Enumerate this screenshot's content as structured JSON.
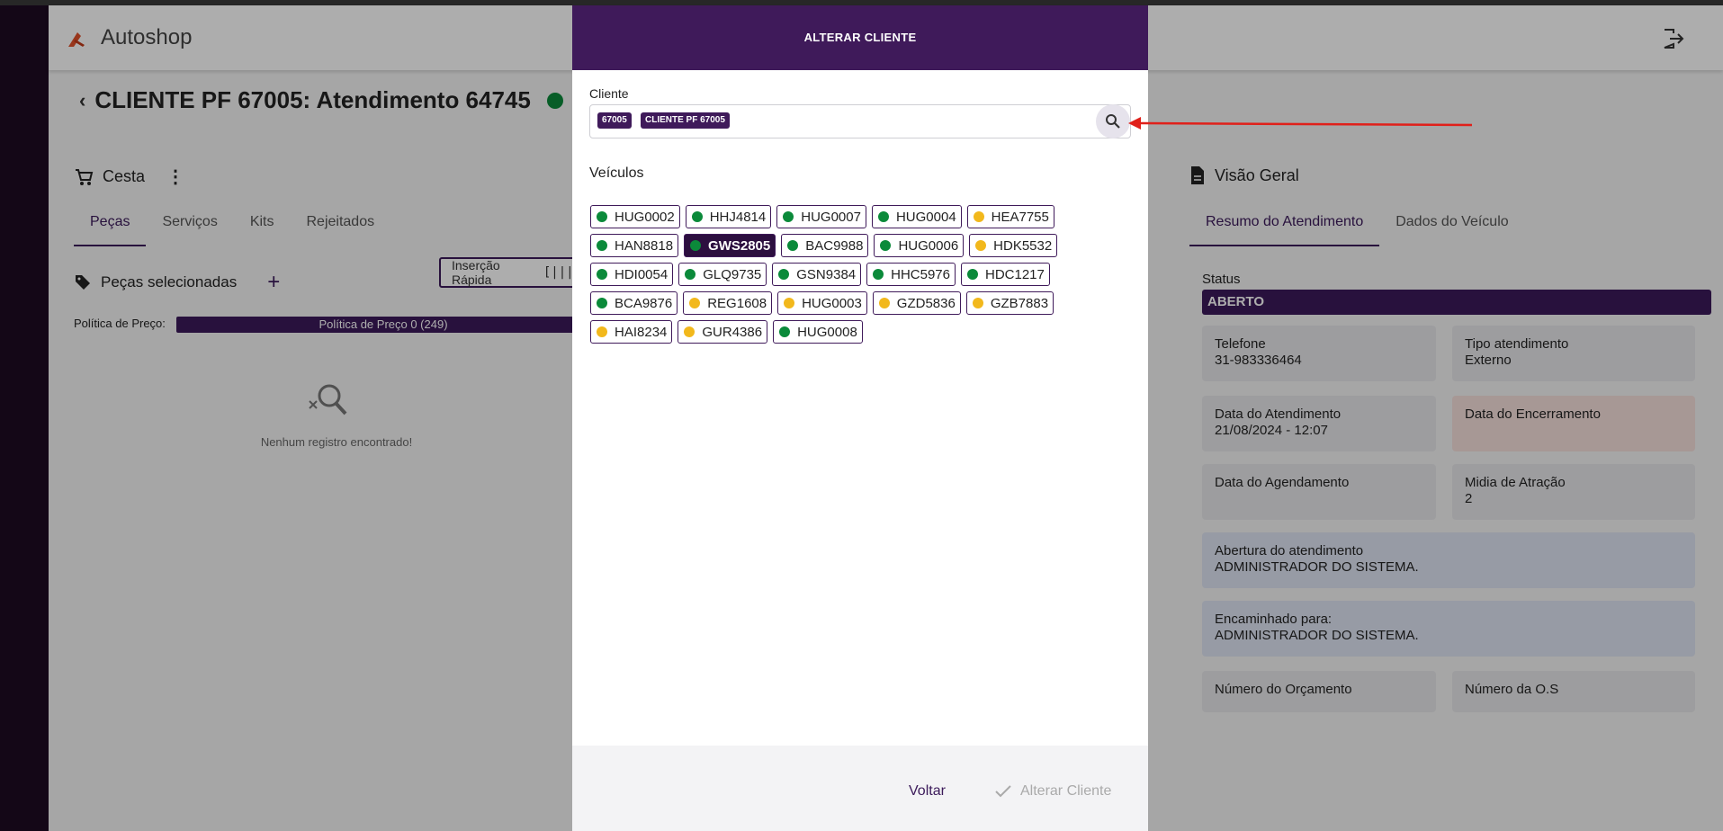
{
  "app": {
    "brand": "Autoshop",
    "page_title": "CLIENTE PF 67005: Atendimento 64745",
    "accent_color": "#3f1a5a",
    "status_dot_color": "#0b8a3a"
  },
  "left": {
    "cesta_label": "Cesta",
    "tabs": [
      "Peças",
      "Serviços",
      "Kits",
      "Rejeitados"
    ],
    "active_tab": "Peças",
    "pecas_selecionadas": "Peças selecionadas",
    "quick_insert_label": "Inserção Rápida",
    "politica_label": "Política de Preço:",
    "politica_value": "Política de Preço 0 (249)",
    "empty_text": "Nenhum registro encontrado!"
  },
  "right": {
    "title": "Visão Geral",
    "tabs": [
      "Resumo do Atendimento",
      "Dados do Veículo"
    ],
    "active_tab": "Resumo do Atendimento",
    "status_label": "Status",
    "status_value": "ABERTO",
    "cards": {
      "telefone": {
        "label": "Telefone",
        "value": "31-983336464"
      },
      "tipo": {
        "label": "Tipo atendimento",
        "value": "Externo"
      },
      "data_atendimento": {
        "label": "Data do Atendimento",
        "value": "21/08/2024 - 12:07"
      },
      "data_encerramento": {
        "label": "Data do Encerramento",
        "value": ""
      },
      "data_agendamento": {
        "label": "Data do Agendamento",
        "value": ""
      },
      "midia": {
        "label": "Midia de Atração",
        "value": "2"
      },
      "abertura": {
        "label": "Abertura do atendimento",
        "value": "ADMINISTRADOR DO SISTEMA."
      },
      "encaminhado": {
        "label": "Encaminhado para:",
        "value": "ADMINISTRADOR DO SISTEMA."
      },
      "orcamento": {
        "label": "Número do Orçamento",
        "value": ""
      },
      "os": {
        "label": "Número da O.S",
        "value": ""
      }
    }
  },
  "dialog": {
    "title": "ALTERAR CLIENTE",
    "cliente_label": "Cliente",
    "chips": [
      "67005",
      "CLIENTE PF 67005"
    ],
    "veiculos_label": "Veículos",
    "vehicles": [
      {
        "plate": "HUG0002",
        "status": "green"
      },
      {
        "plate": "HHJ4814",
        "status": "green"
      },
      {
        "plate": "HUG0007",
        "status": "green"
      },
      {
        "plate": "HUG0004",
        "status": "green"
      },
      {
        "plate": "HEA7755",
        "status": "yellow"
      },
      {
        "plate": "HAN8818",
        "status": "green"
      },
      {
        "plate": "GWS2805",
        "status": "green",
        "selected": true
      },
      {
        "plate": "BAC9988",
        "status": "green"
      },
      {
        "plate": "HUG0006",
        "status": "green"
      },
      {
        "plate": "HDK5532",
        "status": "yellow"
      },
      {
        "plate": "HDI0054",
        "status": "green"
      },
      {
        "plate": "GLQ9735",
        "status": "green"
      },
      {
        "plate": "GSN9384",
        "status": "green"
      },
      {
        "plate": "HHC5976",
        "status": "green"
      },
      {
        "plate": "HDC1217",
        "status": "green"
      },
      {
        "plate": "BCA9876",
        "status": "green"
      },
      {
        "plate": "REG1608",
        "status": "yellow"
      },
      {
        "plate": "HUG0003",
        "status": "yellow"
      },
      {
        "plate": "GZD5836",
        "status": "yellow"
      },
      {
        "plate": "GZB7883",
        "status": "yellow"
      },
      {
        "plate": "HAI8234",
        "status": "yellow"
      },
      {
        "plate": "GUR4386",
        "status": "yellow"
      },
      {
        "plate": "HUG0008",
        "status": "green"
      }
    ],
    "status_colors": {
      "green": "#0b8a3a",
      "yellow": "#f2b81c"
    },
    "voltar_label": "Voltar",
    "alterar_label": "Alterar Cliente"
  }
}
